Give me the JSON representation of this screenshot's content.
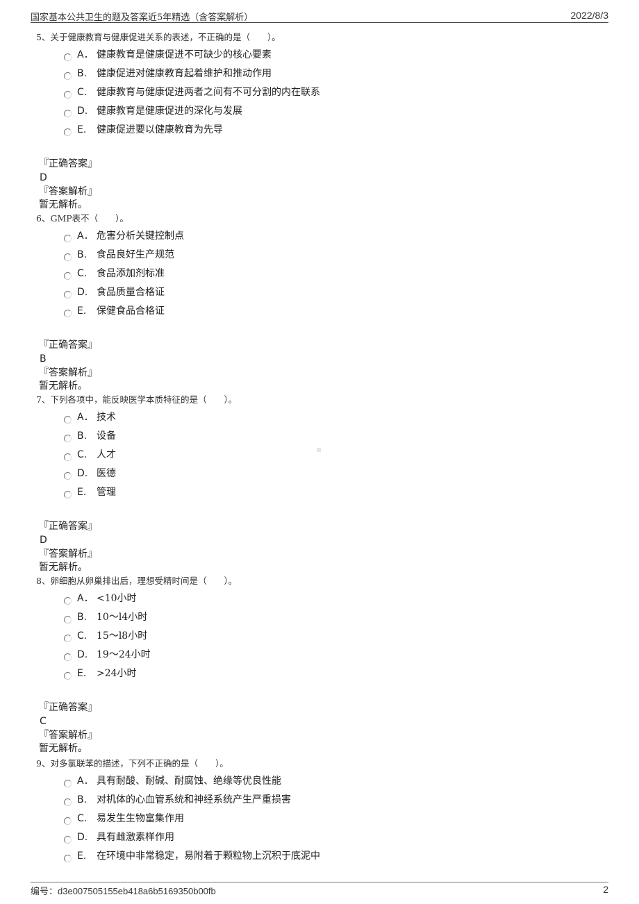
{
  "header": {
    "title": "国家基本公共卫生的题及答案近5年精选（含答案解析）",
    "date": "2022/8/3"
  },
  "labels": {
    "correct_answer": "『正确答案』",
    "analysis": "『答案解析』"
  },
  "questions": [
    {
      "stem": "5、关于健康教育与健康促进关系的表述，不正确的是（　　）。",
      "options": [
        {
          "letter": "A．",
          "text": "健康教育是健康促进不可缺少的核心要素"
        },
        {
          "letter": "B.",
          "text": "健康促进对健康教育起着维护和推动作用"
        },
        {
          "letter": "C.",
          "text": "健康教育与健康促进两者之间有不可分割的内在联系"
        },
        {
          "letter": "D.",
          "text": "健康教育是健康促进的深化与发展"
        },
        {
          "letter": "E.",
          "text": "健康促进要以健康教育为先导"
        }
      ],
      "answer": "D",
      "analysis": "暂无解析。"
    },
    {
      "stem": "6、GMP表不（　　）。",
      "options": [
        {
          "letter": "A．",
          "text": "危害分析关键控制点"
        },
        {
          "letter": "B.",
          "text": "食品良好生产规范"
        },
        {
          "letter": "C.",
          "text": "食品添加剂标准"
        },
        {
          "letter": "D.",
          "text": "食品质量合格证"
        },
        {
          "letter": "E.",
          "text": "保健食品合格证"
        }
      ],
      "answer": "B",
      "analysis": "暂无解析。"
    },
    {
      "stem": "7、下列各项中，能反映医学本质特征的是（　　）。",
      "options": [
        {
          "letter": "A．",
          "text": "技术"
        },
        {
          "letter": "B.",
          "text": "设备"
        },
        {
          "letter": "C.",
          "text": "人才"
        },
        {
          "letter": "D.",
          "text": "医德"
        },
        {
          "letter": "E.",
          "text": "管理"
        }
      ],
      "answer": "D",
      "analysis": "暂无解析。"
    },
    {
      "stem": "8、卵细胞从卵巢排出后，理想受精时间是（　　）。",
      "options": [
        {
          "letter": "A．",
          "text": "<10小时"
        },
        {
          "letter": "B.",
          "text": "10～l4小时"
        },
        {
          "letter": "C.",
          "text": "15～l8小时"
        },
        {
          "letter": "D.",
          "text": "19～24小时"
        },
        {
          "letter": "E.",
          "text": ">24小时"
        }
      ],
      "answer": "C",
      "analysis": "暂无解析。"
    },
    {
      "stem": "9、对多氯联苯的描述，下列不正确的是（　　）。",
      "options": [
        {
          "letter": "A．",
          "text": "具有耐酸、耐碱、耐腐蚀、绝缘等优良性能"
        },
        {
          "letter": "B.",
          "text": "对机体的心血管系统和神经系统产生严重损害"
        },
        {
          "letter": "C.",
          "text": "易发生生物富集作用"
        },
        {
          "letter": "D.",
          "text": "具有雌激素样作用"
        },
        {
          "letter": "E.",
          "text": "在环境中非常稳定，易附着于颗粒物上沉积于底泥中"
        }
      ]
    }
  ],
  "footer": {
    "code_label": "编号：",
    "code_value": "d3e007505155eb418a6b5169350b00fb",
    "page_number": "2"
  }
}
